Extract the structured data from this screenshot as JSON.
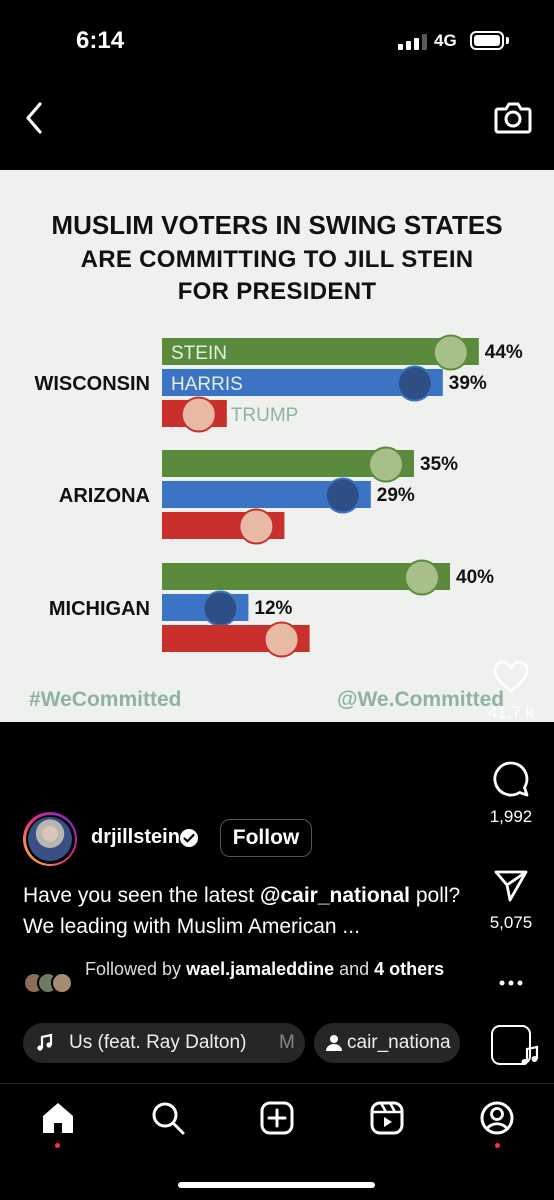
{
  "status_bar": {
    "time": "6:14",
    "network": "4G"
  },
  "chart_data": {
    "type": "bar",
    "title": "MUSLIM VOTERS IN SWING STATES",
    "subtitle_lines": [
      "ARE COMMITTING TO JILL STEIN",
      "FOR PRESIDENT"
    ],
    "categories": [
      "WISCONSIN",
      "ARIZONA",
      "MICHIGAN"
    ],
    "series": [
      {
        "name": "STEIN",
        "color": "#5a8a3c",
        "values": [
          44,
          35,
          40
        ],
        "labels": [
          "44%",
          "35%",
          "40%"
        ]
      },
      {
        "name": "HARRIS",
        "color": "#3b73c5",
        "values": [
          39,
          29,
          12
        ],
        "labels": [
          "39%",
          "29%",
          "12%"
        ]
      },
      {
        "name": "TRUMP",
        "color": "#c9302c",
        "values": [
          9,
          17,
          20.5
        ],
        "labels": [
          "",
          "",
          ""
        ]
      }
    ],
    "orientation": "horizontal",
    "grid": false
  },
  "post": {
    "hashtag": "#WeCommitted",
    "handle": "@We.Committed",
    "likes": "41.7 k",
    "comments": "1,992",
    "shares": "5,075",
    "username": "drjillstein",
    "follow_label": "Follow",
    "caption_prefix": "Have you seen the latest ",
    "caption_mention": "@cair_national",
    "caption_suffix": " poll? We leading with Muslim American ...",
    "followed_by_prefix": "Followed by ",
    "followed_by_user": "wael.jamaleddine",
    "followed_by_suffix": " and ",
    "followed_by_others": "4 others",
    "audio_label": "Us (feat. Ray Dalton)",
    "audio_trail": "M",
    "tagged_user": "cair_nationa"
  },
  "icons": {
    "back": "chevron-left-icon",
    "camera": "camera-icon",
    "heart": "heart-icon",
    "comment": "comment-icon",
    "share": "send-icon",
    "more": "more-icon",
    "music": "music-note-icon",
    "person": "person-icon"
  },
  "colors": {
    "stein": "#5a8a3c",
    "harris": "#3b73c5",
    "trump": "#c9302c",
    "hashtag": "#8fb3a0",
    "notification_dot": "#ff3040"
  }
}
